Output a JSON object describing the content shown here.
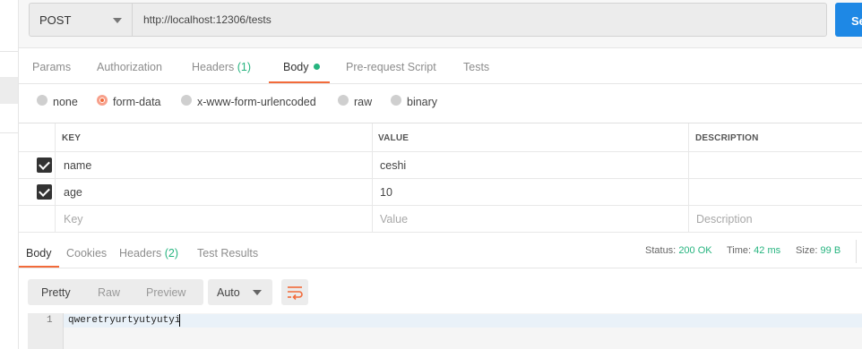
{
  "request": {
    "method": "POST",
    "url": "http://localhost:12306/tests",
    "send_label": "Se"
  },
  "request_tabs": [
    {
      "label": "Params"
    },
    {
      "label": "Authorization"
    },
    {
      "label": "Headers",
      "count": "(1)"
    },
    {
      "label": "Body",
      "active": true
    },
    {
      "label": "Pre-request Script"
    },
    {
      "label": "Tests"
    }
  ],
  "body_types": [
    {
      "label": "none"
    },
    {
      "label": "form-data",
      "selected": true
    },
    {
      "label": "x-www-form-urlencoded"
    },
    {
      "label": "raw"
    },
    {
      "label": "binary"
    }
  ],
  "params_table": {
    "headers": [
      "KEY",
      "VALUE",
      "DESCRIPTION"
    ],
    "rows": [
      {
        "checked": true,
        "key": "name",
        "value": "ceshi",
        "description": ""
      },
      {
        "checked": true,
        "key": "age",
        "value": "10",
        "description": ""
      }
    ],
    "placeholders": {
      "key": "Key",
      "value": "Value",
      "description": "Description"
    }
  },
  "response_tabs": [
    {
      "label": "Body",
      "active": true
    },
    {
      "label": "Cookies"
    },
    {
      "label": "Headers",
      "count": "(2)"
    },
    {
      "label": "Test Results"
    }
  ],
  "response_status": {
    "status_label": "Status:",
    "status_value": "200 OK",
    "time_label": "Time:",
    "time_value": "42 ms",
    "size_label": "Size:",
    "size_value": "99 B"
  },
  "view_modes": [
    {
      "label": "Pretty",
      "active": true
    },
    {
      "label": "Raw"
    },
    {
      "label": "Preview"
    }
  ],
  "format_select": "Auto",
  "editor": {
    "line_number": "1",
    "content": "qweretryurtyutyutyi"
  },
  "colors": {
    "accent": "#f26b3a",
    "success": "#26b47f",
    "send": "#1e88e5"
  }
}
